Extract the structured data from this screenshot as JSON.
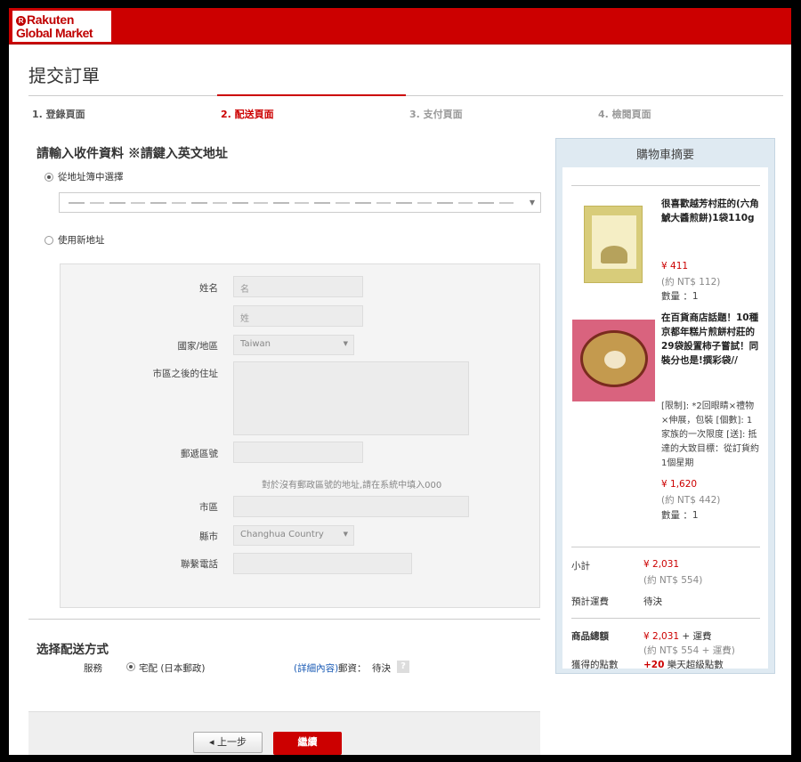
{
  "brand": {
    "line1": "Rakuten",
    "line2": "Global Market",
    "mark": "R"
  },
  "page_title": "提交訂單",
  "steps": [
    {
      "label": "1. 登錄頁面"
    },
    {
      "label": "2. 配送頁面"
    },
    {
      "label": "3. 支付頁面"
    },
    {
      "label": "4. 檢閱頁面"
    }
  ],
  "address": {
    "title": "請輸入收件資料 ※請鍵入英文地址",
    "option_book": "從地址簿中選擇",
    "option_new": "使用新地址",
    "form": {
      "name_label": "姓名",
      "first_placeholder": "名",
      "last_placeholder": "姓",
      "country_label": "國家/地區",
      "country_value": "Taiwan",
      "street_label": "市區之後的住址",
      "postal_label": "郵遞區號",
      "postal_hint": "對於沒有郵政區號的地址,請在系統中填入000",
      "city_label": "市區",
      "county_label": "縣市",
      "county_value": "Changhua Country",
      "phone_label": "聯繫電話"
    }
  },
  "shipping": {
    "title": "选择配送方式",
    "service_label": "服務",
    "method": "宅配 (日本郵政)",
    "detail_link": "(詳細內容)",
    "fee_label": "郵資：",
    "fee_value": "待決",
    "help": "?"
  },
  "buttons": {
    "back": "◂ 上一步",
    "next": "繼續"
  },
  "cart": {
    "title": "購物車摘要",
    "items": [
      {
        "name": "很喜歡越芳村莊的(六角鯱大醬煎餅)1袋110g",
        "price": "¥ 411",
        "approx": "(約 NT$ 112)",
        "qty": "數量 ：1"
      },
      {
        "name": "在百貨商店話題！10種京都年糕片煎餅村莊的29袋設置柿子嘗試！同裝分也是!撰彩袋//",
        "options": "[限制]: *2回眼睛×禮物×伸展，包裝 [個數]: 1家族的一次限度 [送]: 抵達的大致目標：從訂貨約1個星期",
        "price": "¥ 1,620",
        "approx": "(約 NT$ 442)",
        "qty": "數量 ：1"
      }
    ],
    "subtotal_label": "小計",
    "subtotal": "¥ 2,031",
    "subtotal_approx": "(約 NT$ 554)",
    "shipping_label": "預計運費",
    "shipping_value": "待決",
    "total_label": "商品總額",
    "total_price": "¥ 2,031",
    "total_suffix": " + 運費",
    "total_approx": "(約 NT$ 554 + 運費)",
    "points_label": "獲得的點數",
    "points_value": "+20",
    "points_suffix": " 樂天超級點數"
  }
}
